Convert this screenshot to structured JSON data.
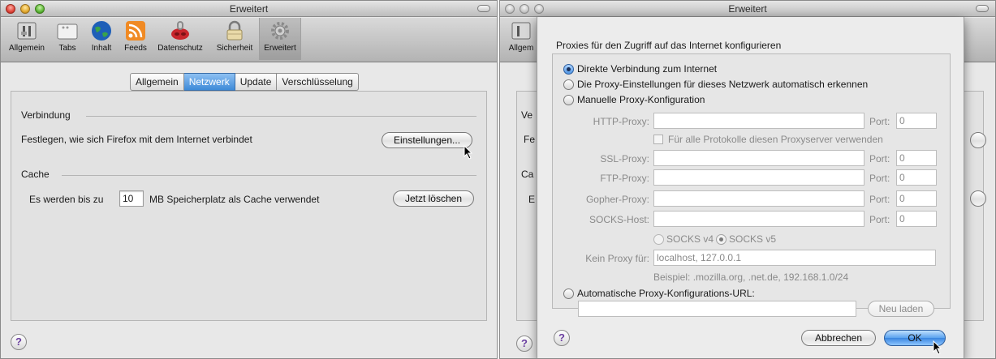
{
  "window1": {
    "title": "Erweitert",
    "toolbar": [
      "Allgemein",
      "Tabs",
      "Inhalt",
      "Feeds",
      "Datenschutz",
      "Sicherheit",
      "Erweitert"
    ],
    "tabs": [
      "Allgemein",
      "Netzwerk",
      "Update",
      "Verschlüsselung"
    ],
    "active_tab": "Netzwerk",
    "connection": {
      "title": "Verbindung",
      "description": "Festlegen, wie sich Firefox mit dem Internet verbindet",
      "button": "Einstellungen..."
    },
    "cache": {
      "title": "Cache",
      "text_before": "Es werden bis zu",
      "value": "10",
      "text_after": "MB Speicherplatz als Cache verwendet",
      "button": "Jetzt löschen"
    },
    "help": "?"
  },
  "window2": {
    "title": "Erweitert",
    "toolbar_partial": "Allgem",
    "bg_partial": {
      "a": "Ve",
      "b": "Fe",
      "c": "Ca",
      "d": "E"
    },
    "help": "?"
  },
  "sheet": {
    "title": "Proxies für den Zugriff auf das Internet konfigurieren",
    "options": {
      "direct": "Direkte Verbindung zum Internet",
      "auto_detect": "Die Proxy-Einstellungen für dieses Netzwerk automatisch erkennen",
      "manual": "Manuelle Proxy-Konfiguration",
      "auto_url": "Automatische Proxy-Konfigurations-URL:"
    },
    "port_label": "Port:",
    "http": {
      "label": "HTTP-Proxy:",
      "value": "",
      "port": "0"
    },
    "same_for_all": "Für alle Protokolle diesen Proxyserver verwenden",
    "ssl": {
      "label": "SSL-Proxy:",
      "value": "",
      "port": "0"
    },
    "ftp": {
      "label": "FTP-Proxy:",
      "value": "",
      "port": "0"
    },
    "gopher": {
      "label": "Gopher-Proxy:",
      "value": "",
      "port": "0"
    },
    "socks": {
      "label": "SOCKS-Host:",
      "value": "",
      "port": "0"
    },
    "socks_v4": "SOCKS v4",
    "socks_v5": "SOCKS v5",
    "no_proxy": {
      "label": "Kein Proxy für:",
      "value": "localhost, 127.0.0.1"
    },
    "example": "Beispiel: .mozilla.org, .net.de, 192.168.1.0/24",
    "reload": "Neu laden",
    "cancel": "Abbrechen",
    "ok": "OK",
    "help": "?"
  }
}
